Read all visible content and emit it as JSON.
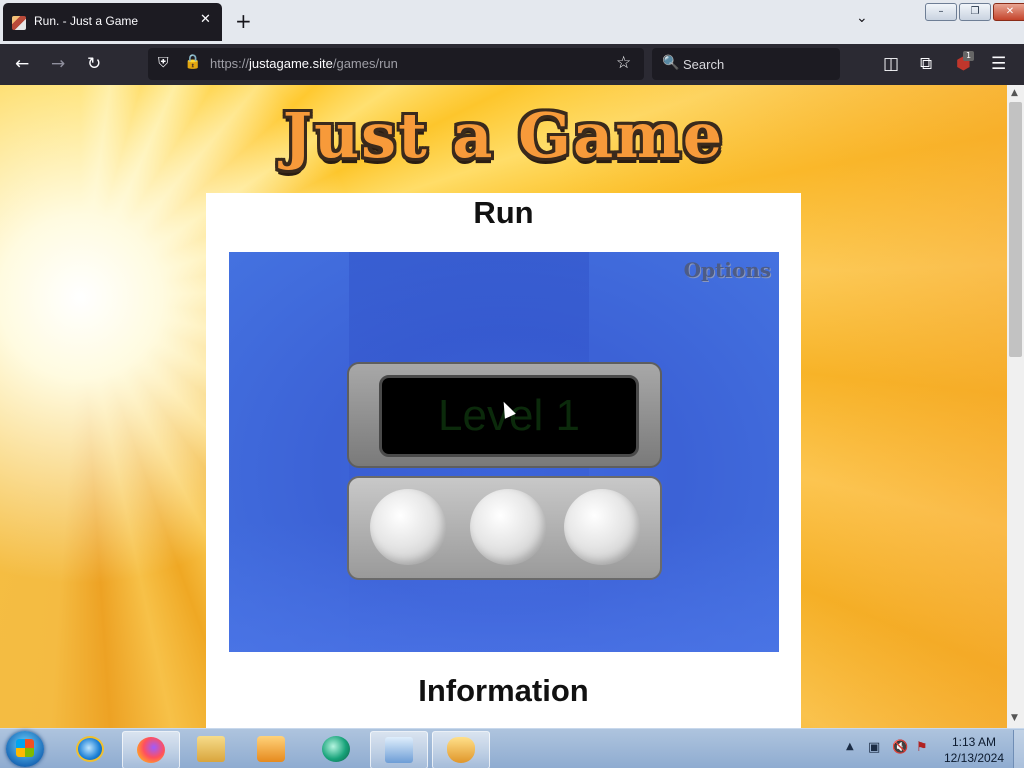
{
  "browser": {
    "tab": {
      "title": "Run. - Just a Game",
      "close_glyph": "✕"
    },
    "new_tab_glyph": "+",
    "tabs_list_glyph": "⌄",
    "window_buttons": {
      "minimize": "–",
      "restore": "❐",
      "close": "✕"
    },
    "nav": {
      "back": "←",
      "forward": "→",
      "reload": "↻",
      "shield": "⛨",
      "lock": "🔒",
      "star": "☆"
    },
    "url": {
      "scheme": "https://",
      "host": "justagame.site",
      "path": "/games/run"
    },
    "search": {
      "icon": "🔍",
      "placeholder": "Search"
    },
    "toolbar": {
      "pocket": "◫",
      "extensions": "⧉",
      "ublock": "⬢",
      "ublock_badge": "1",
      "menu": "☰"
    }
  },
  "page": {
    "logo_text": "Just a Game",
    "game_title": "Run",
    "game": {
      "options_label": "Options",
      "level_text": "Level 1",
      "lights_count": 3
    },
    "section_title": "Information"
  },
  "scrollbar": {
    "up": "▲",
    "down": "▼"
  },
  "taskbar": {
    "clock_time": "1:13 AM",
    "clock_date": "12/13/2024",
    "tray_arrow": "▲",
    "tray": {
      "network": "▣",
      "volume": "🔇",
      "flag": "⚑"
    }
  },
  "colors": {
    "game_bg": "#3f6ae0",
    "logo_fill": "#f79a3a",
    "logo_outline": "#3a2a1c"
  }
}
